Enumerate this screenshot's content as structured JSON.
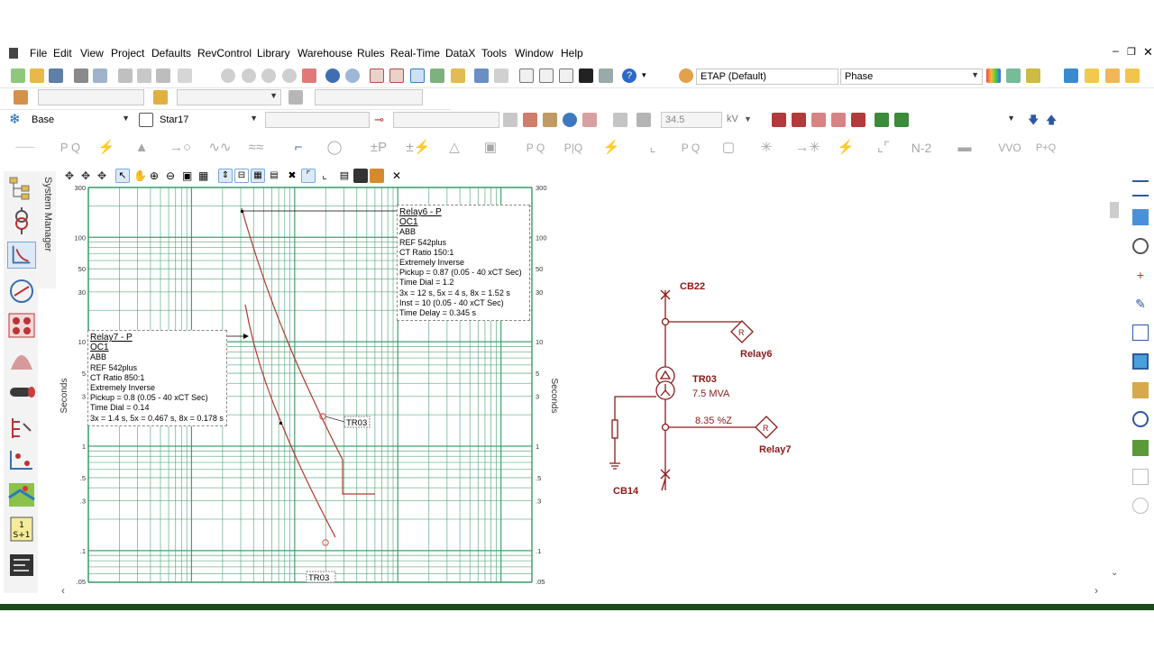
{
  "menu": [
    "File",
    "Edit",
    "View",
    "Project",
    "Defaults",
    "RevControl",
    "Library",
    "Warehouse",
    "Rules",
    "Real-Time",
    "DataX",
    "Tools",
    "Window",
    "Help"
  ],
  "toolbar": {
    "config_select": "ETAP (Default)",
    "phase_select": "Phase",
    "presentation_select": "Base",
    "study_select": "Star17",
    "kv_value": "34.5",
    "kv_unit": "kV"
  },
  "mode_icons": [
    "P Q",
    "±P",
    "N-2",
    "VVO",
    "P+Q"
  ],
  "system_manager": "System Manager",
  "tcc": {
    "y_axis_label": "Seconds",
    "y_ticks": [
      ".05",
      ".1",
      ".3",
      ".5",
      "1",
      "3",
      "5",
      "10",
      "30",
      "50",
      "100",
      "300"
    ],
    "relay6": {
      "title": "Relay6 - P",
      "function": "OC1",
      "lines": [
        "ABB",
        "REF 542plus",
        "CT Ratio 150:1",
        "Extremely Inverse",
        "Pickup = 0.87 (0.05 - 40  xCT Sec)",
        "Time Dial = 1.2",
        "3x = 12 s, 5x = 4 s, 8x = 1.52 s",
        "Inst = 10 (0.05 - 40  xCT Sec)",
        "Time Delay = 0.345 s"
      ]
    },
    "relay7": {
      "title": "Relay7 - P",
      "function": "OC1",
      "lines": [
        "ABB",
        "REF 542plus",
        "CT Ratio 850:1",
        "Extremely Inverse",
        "Pickup = 0.8 (0.05 - 40  xCT Sec)",
        "Time Dial = 0.14",
        "3x = 1.4 s, 5x = 0.467 s, 8x = 0.178 s"
      ]
    },
    "tr03_label": "TR03",
    "tr03_label_bottom": "TR03"
  },
  "sld": {
    "cb22": "CB22",
    "relay6": "Relay6",
    "tr03": "TR03",
    "tr03_rating": "7.5 MVA",
    "impedance": "8.35 %Z",
    "relay7": "Relay7",
    "cb14": "CB14",
    "relay_symbol": "R"
  },
  "colors": {
    "grid": "#3a9a6a",
    "curve": "#b03a2e",
    "sld": "#8b1a1a",
    "status_bar": "#1c4a1c"
  }
}
